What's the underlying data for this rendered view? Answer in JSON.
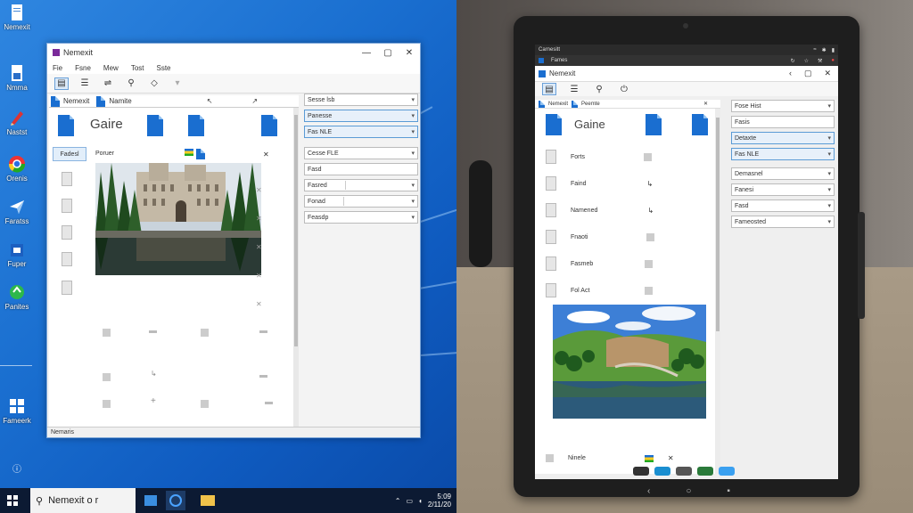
{
  "desktop": {
    "icons": [
      {
        "label": "Nemexit",
        "icon": "document-icon"
      },
      {
        "label": "Nmma",
        "icon": "document-icon"
      },
      {
        "label": "Nastst",
        "icon": "pen-icon"
      },
      {
        "label": "Orenis",
        "icon": "chrome-icon"
      },
      {
        "label": "Faratss",
        "icon": "paper-plane-icon"
      },
      {
        "label": "Fuper",
        "icon": "store-icon"
      },
      {
        "label": "Panites",
        "icon": "recycle-icon"
      },
      {
        "label": "Fameerk",
        "icon": "windows-grid-icon"
      }
    ]
  },
  "window": {
    "title": "Nemexit",
    "menu": [
      "Fie",
      "Fsne",
      "Mew",
      "Tost",
      "Sste"
    ],
    "tab_a": "Nemexit",
    "tab_b": "Namite",
    "main_label": "Gaire",
    "sidebar_item": "Fadesl",
    "item_label": "Poruer",
    "status": "Nemaris"
  },
  "right_panel": {
    "fields": [
      {
        "label": "Sesse lsb",
        "highlight": false
      },
      {
        "label": "Panesse",
        "highlight": true
      },
      {
        "label": "Fas NLE",
        "highlight": true
      },
      {
        "label": "Cesse FLE",
        "highlight": false
      },
      {
        "label": "Fasd",
        "highlight": false
      },
      {
        "label": "Fasred",
        "highlight": false
      },
      {
        "label": "Fonad",
        "highlight": false
      },
      {
        "label": "Feasdp",
        "highlight": false
      }
    ]
  },
  "taskbar": {
    "search_text": "Nemexit o r",
    "time": "5:09",
    "date": "2/11/20"
  },
  "tablet": {
    "status_left": "Carnesitt",
    "status_tab": "Fames",
    "title": "Nemexit",
    "tabs": [
      "Nemexit",
      "Peemte"
    ],
    "main_label": "Gaine",
    "items": [
      "Forts",
      "Faind",
      "Namened",
      "Fnaoti",
      "Fasmeb",
      "Fol Act"
    ],
    "bottom_item": "Ninele",
    "fields": [
      {
        "label": "Fose Hist",
        "highlight": false
      },
      {
        "label": "Fasis",
        "highlight": false
      },
      {
        "label": "Detaxte",
        "highlight": true
      },
      {
        "label": "Fas NLE",
        "highlight": true
      },
      {
        "label": "Demasnel",
        "highlight": false
      },
      {
        "label": "Fanesi",
        "highlight": false
      },
      {
        "label": "Fasd",
        "highlight": false
      },
      {
        "label": "Fameosted",
        "highlight": false
      }
    ]
  }
}
